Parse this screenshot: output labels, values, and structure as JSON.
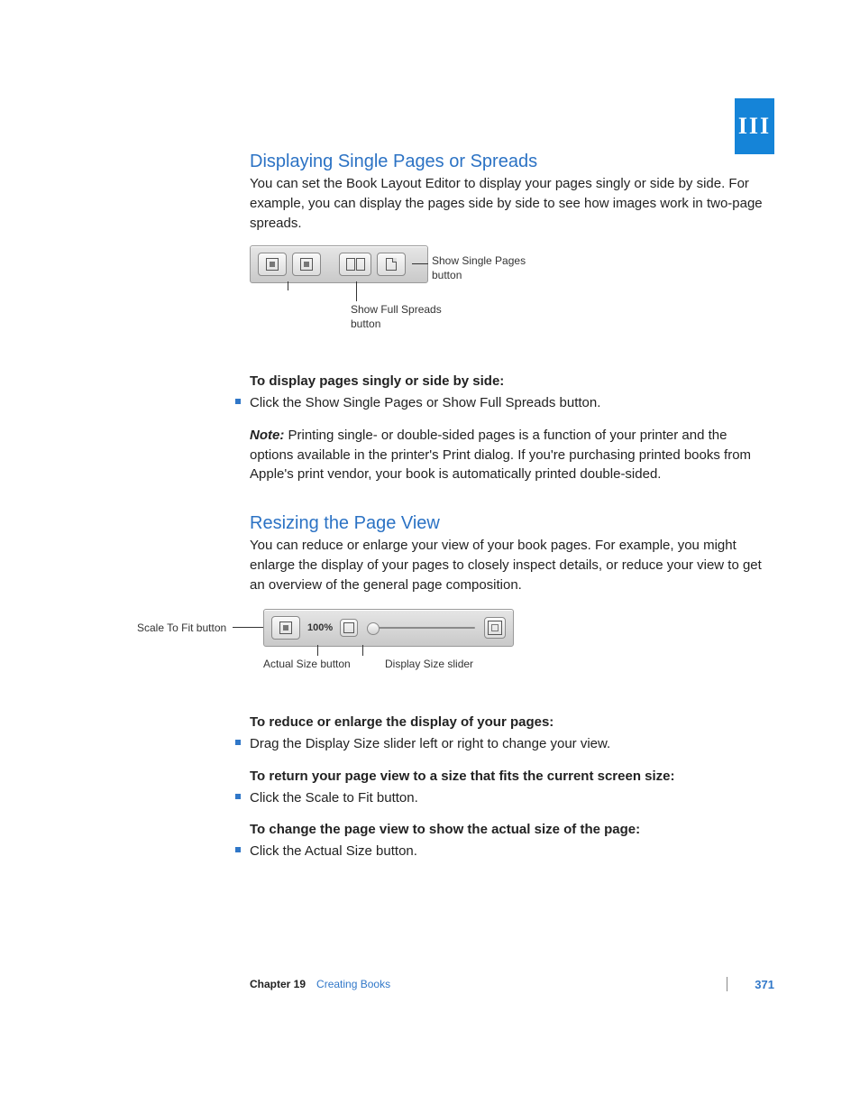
{
  "tab": {
    "part": "III"
  },
  "section1": {
    "heading": "Displaying Single Pages or Spreads",
    "para1": "You can set the Book Layout Editor to display your pages singly or side by side. For example, you can display the pages side by side to see how images work in two-page spreads.",
    "fig": {
      "callout_right_a": "Show Single Pages",
      "callout_right_b": "button",
      "callout_bottom_a": "Show Full Spreads",
      "callout_bottom_b": "button"
    },
    "lead": "To display pages singly or side by side:",
    "bullet1": "Click the Show Single Pages or Show Full Spreads button.",
    "note_label": "Note:",
    "note_body": "  Printing single- or double-sided pages is a function of your printer and the options available in the printer's Print dialog. If you're purchasing printed books from Apple's print vendor, your book is automatically printed double-sided."
  },
  "section2": {
    "heading": "Resizing the Page View",
    "para1": "You can reduce or enlarge your view of your book pages. For example, you might enlarge the display of your pages to closely inspect details, or reduce your view to get an overview of the general page composition.",
    "fig": {
      "pct": "100%",
      "cl_left": "Scale To Fit button",
      "cl_b1": "Actual Size button",
      "cl_b2": "Display Size slider"
    },
    "lead2": "To reduce or enlarge the display of your pages:",
    "bullet2": "Drag the Display Size slider left or right to change your view.",
    "lead3": "To return your page view to a size that fits the current screen size:",
    "bullet3": "Click the Scale to Fit button.",
    "lead4": "To change the page view to show the actual size of the page:",
    "bullet4": "Click the Actual Size button."
  },
  "footer": {
    "chapter_label": "Chapter 19",
    "chapter_title": "Creating Books",
    "page_number": "371"
  }
}
